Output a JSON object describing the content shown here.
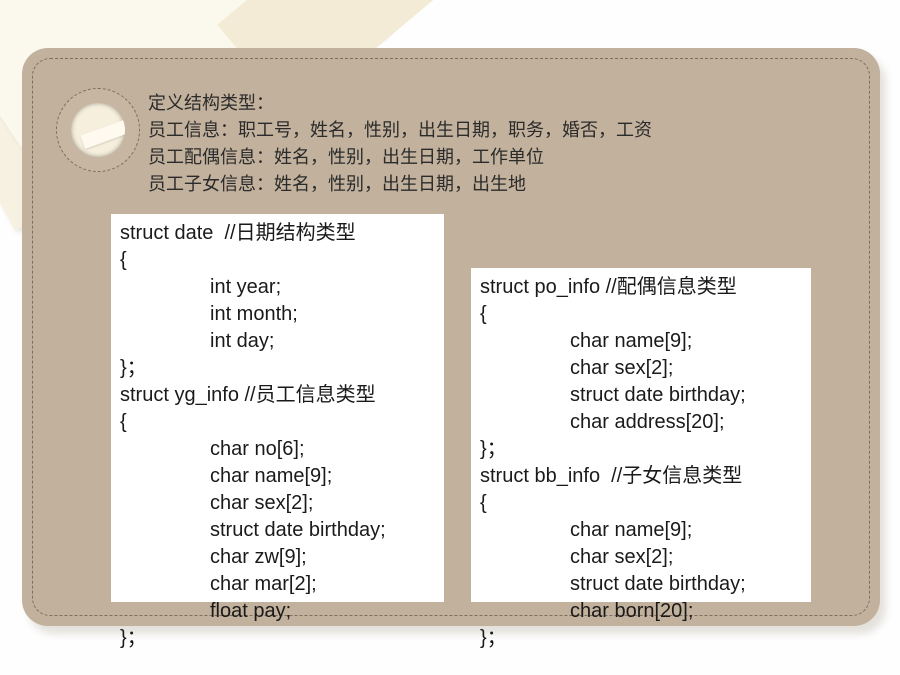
{
  "intro": {
    "lines": [
      "定义结构类型：",
      "员工信息：职工号，姓名，性别，出生日期，职务，婚否，工资",
      "员工配偶信息：姓名，性别，出生日期，工作单位",
      "员工子女信息：姓名，性别，出生日期，出生地"
    ]
  },
  "code_left": {
    "lines": [
      "struct date  //日期结构类型",
      "{",
      "int year;",
      "int month;",
      "int day;",
      "}；",
      "struct yg_info //员工信息类型",
      "{",
      "char no[6];",
      "char name[9];",
      "char sex[2];",
      "struct date birthday;",
      "char zw[9];",
      "char mar[2];",
      "float pay;",
      "}；"
    ]
  },
  "code_right": {
    "lines": [
      "struct po_info //配偶信息类型",
      "{",
      "char name[9];",
      "char sex[2];",
      "struct date birthday;",
      "char address[20];",
      "}；",
      "struct bb_info  //子女信息类型",
      "{",
      "char name[9];",
      "char sex[2];",
      "struct date birthday;",
      "char born[20];",
      "}；"
    ]
  },
  "colors": {
    "card": "#c2b19c",
    "stitch": "#7d6f5f",
    "code_background": "#ffffff"
  }
}
